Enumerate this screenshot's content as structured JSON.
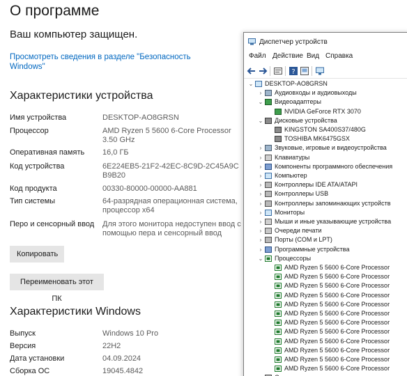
{
  "settings": {
    "page_title": "О программе",
    "protected_text": "Ваш компьютер защищен.",
    "security_link": "Просмотреть сведения в разделе \"Безопасность Windows\"",
    "device_specs": {
      "title": "Характеристики устройства",
      "rows": [
        {
          "label": "Имя устройства",
          "value": "DESKTOP-AO8GRSN"
        },
        {
          "label": "Процессор",
          "value": "AMD Ryzen 5 5600 6-Core Processor 3.50 GHz"
        },
        {
          "label": "Оперативная память",
          "value": "16,0 ГБ"
        },
        {
          "label": "Код устройства",
          "value": "6E224EB5-21F2-42EC-8C9D-2C45A9CB9B20"
        },
        {
          "label": "Код продукта",
          "value": "00330-80000-00000-AA881"
        },
        {
          "label": "Тип системы",
          "value": "64-разрядная операционная система, процессор x64"
        },
        {
          "label": "Перо и сенсорный ввод",
          "value": "Для этого монитора недоступен ввод с помощью пера и сенсорный ввод"
        }
      ],
      "copy_button": "Копировать",
      "rename_button": "Переименовать этот ПК"
    },
    "windows_specs": {
      "title": "Характеристики Windows",
      "rows": [
        {
          "label": "Выпуск",
          "value": "Windows 10 Pro"
        },
        {
          "label": "Версия",
          "value": "22H2"
        },
        {
          "label": "Дата установки",
          "value": "04.09.2024"
        },
        {
          "label": "Сборка ОС",
          "value": "19045.4842"
        }
      ]
    }
  },
  "device_manager": {
    "title": "Диспетчер устройств",
    "menu": [
      "Файл",
      "Действие",
      "Вид",
      "Справка"
    ],
    "toolbar_icons": [
      "back-icon",
      "forward-icon",
      "properties-icon",
      "help-icon",
      "scan-icon",
      "monitor-icon"
    ],
    "tree": [
      {
        "level": 0,
        "state": "expanded",
        "icon": "computer",
        "label": "DESKTOP-AO8GRSN"
      },
      {
        "level": 1,
        "state": "collapsed",
        "icon": "audio",
        "label": "Аудиовходы и аудиовыходы"
      },
      {
        "level": 1,
        "state": "expanded",
        "icon": "display",
        "label": "Видеоадаптеры"
      },
      {
        "level": 2,
        "state": "leaf",
        "icon": "display",
        "label": "NVIDIA GeForce RTX 3070"
      },
      {
        "level": 1,
        "state": "expanded",
        "icon": "disk",
        "label": "Дисковые устройства"
      },
      {
        "level": 2,
        "state": "leaf",
        "icon": "disk",
        "label": "KINGSTON SA400S37/480G"
      },
      {
        "level": 2,
        "state": "leaf",
        "icon": "disk",
        "label": "TOSHIBA MK6475GSX"
      },
      {
        "level": 1,
        "state": "collapsed",
        "icon": "sound",
        "label": "Звуковые, игровые и видеоустройства"
      },
      {
        "level": 1,
        "state": "collapsed",
        "icon": "keyboard",
        "label": "Клавиатуры"
      },
      {
        "level": 1,
        "state": "collapsed",
        "icon": "software",
        "label": "Компоненты программного обеспечения"
      },
      {
        "level": 1,
        "state": "collapsed",
        "icon": "computer",
        "label": "Компьютер"
      },
      {
        "level": 1,
        "state": "collapsed",
        "icon": "ide",
        "label": "Контроллеры IDE ATA/ATAPI"
      },
      {
        "level": 1,
        "state": "collapsed",
        "icon": "usb",
        "label": "Контроллеры USB"
      },
      {
        "level": 1,
        "state": "collapsed",
        "icon": "storage",
        "label": "Контроллеры запоминающих устройств"
      },
      {
        "level": 1,
        "state": "collapsed",
        "icon": "monitor",
        "label": "Мониторы"
      },
      {
        "level": 1,
        "state": "collapsed",
        "icon": "mouse",
        "label": "Мыши и иные указывающие устройства"
      },
      {
        "level": 1,
        "state": "collapsed",
        "icon": "printer",
        "label": "Очереди печати"
      },
      {
        "level": 1,
        "state": "collapsed",
        "icon": "port",
        "label": "Порты (COM и LPT)"
      },
      {
        "level": 1,
        "state": "collapsed",
        "icon": "software",
        "label": "Программные устройства"
      },
      {
        "level": 1,
        "state": "expanded",
        "icon": "cpu",
        "label": "Процессоры"
      },
      {
        "level": 2,
        "state": "leaf",
        "icon": "cpu",
        "label": "AMD Ryzen 5 5600 6-Core Processor"
      },
      {
        "level": 2,
        "state": "leaf",
        "icon": "cpu",
        "label": "AMD Ryzen 5 5600 6-Core Processor"
      },
      {
        "level": 2,
        "state": "leaf",
        "icon": "cpu",
        "label": "AMD Ryzen 5 5600 6-Core Processor"
      },
      {
        "level": 2,
        "state": "leaf",
        "icon": "cpu",
        "label": "AMD Ryzen 5 5600 6-Core Processor"
      },
      {
        "level": 2,
        "state": "leaf",
        "icon": "cpu",
        "label": "AMD Ryzen 5 5600 6-Core Processor"
      },
      {
        "level": 2,
        "state": "leaf",
        "icon": "cpu",
        "label": "AMD Ryzen 5 5600 6-Core Processor"
      },
      {
        "level": 2,
        "state": "leaf",
        "icon": "cpu",
        "label": "AMD Ryzen 5 5600 6-Core Processor"
      },
      {
        "level": 2,
        "state": "leaf",
        "icon": "cpu",
        "label": "AMD Ryzen 5 5600 6-Core Processor"
      },
      {
        "level": 2,
        "state": "leaf",
        "icon": "cpu",
        "label": "AMD Ryzen 5 5600 6-Core Processor"
      },
      {
        "level": 2,
        "state": "leaf",
        "icon": "cpu",
        "label": "AMD Ryzen 5 5600 6-Core Processor"
      },
      {
        "level": 2,
        "state": "leaf",
        "icon": "cpu",
        "label": "AMD Ryzen 5 5600 6-Core Processor"
      },
      {
        "level": 2,
        "state": "leaf",
        "icon": "cpu",
        "label": "AMD Ryzen 5 5600 6-Core Processor"
      },
      {
        "level": 1,
        "state": "collapsed",
        "icon": "drive",
        "label": "Сетевые адаптеры"
      }
    ]
  }
}
